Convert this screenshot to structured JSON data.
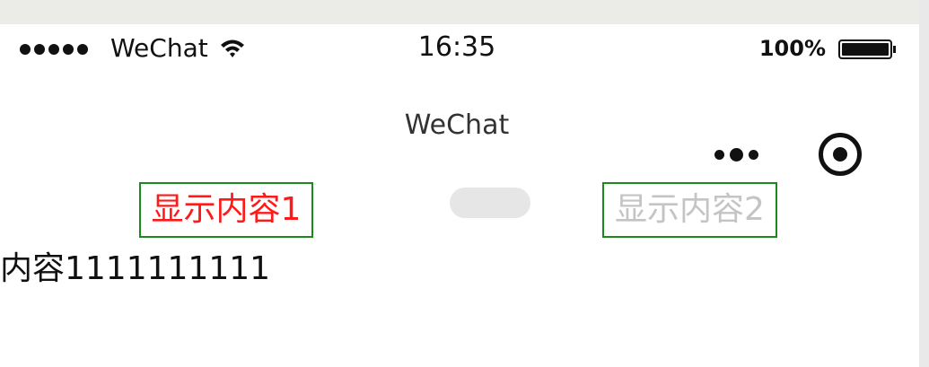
{
  "status_bar": {
    "signal_icon": "signal-dots-icon",
    "carrier": "WeChat",
    "wifi_icon": "wifi-icon",
    "time": "16:35",
    "battery_percent": "100%",
    "battery_icon": "battery-full-icon",
    "battery_level": 1.0
  },
  "nav_bar": {
    "title": "WeChat",
    "menu_icon": "more-dots-icon",
    "close_icon": "target-circle-icon"
  },
  "tabs": [
    {
      "label": "显示内容1",
      "active": true,
      "color": "#ff1a1a"
    },
    {
      "label": "显示内容2",
      "active": false,
      "color": "#c4c4c4"
    }
  ],
  "tab_border_color": "#1a8a1a",
  "content": {
    "text": "内容1111111111"
  }
}
